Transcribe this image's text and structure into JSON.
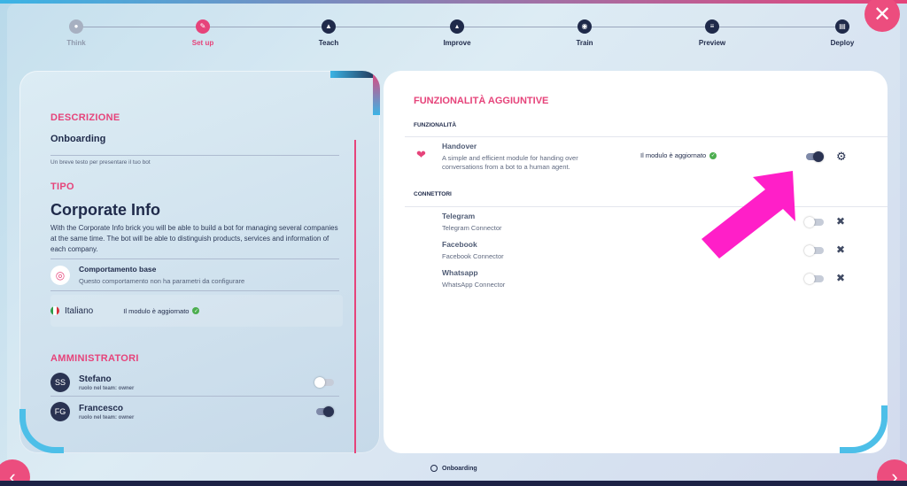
{
  "stepper": {
    "steps": [
      {
        "label": "Think",
        "state": "inactive",
        "icon": "bulb-icon"
      },
      {
        "label": "Set up",
        "state": "active",
        "icon": "pencil-icon"
      },
      {
        "label": "Teach",
        "state": "done",
        "icon": "graduation-cap-icon"
      },
      {
        "label": "Improve",
        "state": "done",
        "icon": "chart-icon"
      },
      {
        "label": "Train",
        "state": "done",
        "icon": "train-icon"
      },
      {
        "label": "Preview",
        "state": "done",
        "icon": "preview-icon"
      },
      {
        "label": "Deploy",
        "state": "done",
        "icon": "deploy-icon"
      }
    ]
  },
  "left": {
    "descrizione_title": "DESCRIZIONE",
    "descrizione_value": "Onboarding",
    "descrizione_hint": "Un breve testo per presentare il tuo bot",
    "tipo_title": "TIPO",
    "tipo_value": "Corporate Info",
    "tipo_text": "With the Corporate Info brick you will be able to build a bot for managing several companies at the same time. The bot will be able to distinguish products, services and information of each company.",
    "behavior_title": "Comportamento base",
    "behavior_sub": "Questo comportamento non ha parametri da configurare",
    "language": "Italiano",
    "language_status": "Il modulo è aggiornato",
    "admin_title": "AMMINISTRATORI",
    "admins": [
      {
        "initials": "SS",
        "name": "Stefano",
        "role": "ruolo nel team: owner",
        "enabled": false
      },
      {
        "initials": "FG",
        "name": "Francesco",
        "role": "ruolo nel team: owner",
        "enabled": true
      }
    ]
  },
  "right": {
    "title": "FUNZIONALITÀ AGGIUNTIVE",
    "features_title": "FUNZIONALITÀ",
    "handover": {
      "name": "Handover",
      "desc_line1": "A simple and efficient module for handing over",
      "desc_line2": "conversations from a bot to a human agent.",
      "status": "Il modulo è aggiornato",
      "enabled": true
    },
    "connectors_title": "CONNETTORI",
    "connectors": [
      {
        "name": "Telegram",
        "desc": "Telegram Connector",
        "enabled": false
      },
      {
        "name": "Facebook",
        "desc": "Facebook Connector",
        "enabled": false
      },
      {
        "name": "Whatsapp",
        "desc": "WhatsApp Connector",
        "enabled": false
      }
    ]
  },
  "footer": {
    "label": "Onboarding"
  },
  "colors": {
    "accent": "#e6437a",
    "navy": "#1f2a4a",
    "cyan": "#4dbfe8",
    "arrow": "#ff1fc8"
  }
}
